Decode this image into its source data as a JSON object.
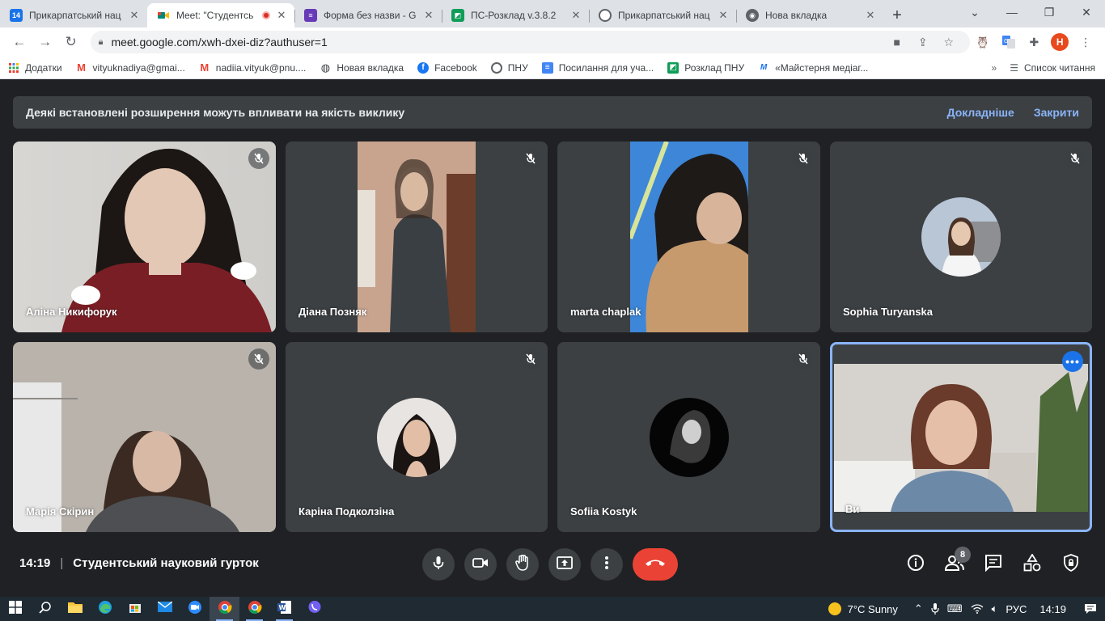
{
  "browser": {
    "tabs": [
      {
        "title": "Прикарпатський нац",
        "favicon": "calendar-icon",
        "color": "#1a73e8",
        "glyph": "14",
        "active": false
      },
      {
        "title": "Meet: \"Студентсь",
        "favicon": "meet-icon",
        "color": "#00897b",
        "glyph": "",
        "active": true,
        "recording": true
      },
      {
        "title": "Форма без назви - G",
        "favicon": "forms-icon",
        "color": "#673ab7",
        "glyph": "",
        "active": false
      },
      {
        "title": "ПС-Розклад v.3.8.2",
        "favicon": "schedule-icon",
        "color": "#0f9d58",
        "glyph": "",
        "active": false
      },
      {
        "title": "Прикарпатський нац",
        "favicon": "university-icon",
        "color": "#5f6368",
        "glyph": "",
        "active": false
      },
      {
        "title": "Нова вкладка",
        "favicon": "chrome-icon",
        "color": "#5f6368",
        "glyph": "",
        "active": false
      }
    ],
    "url": "meet.google.com/xwh-dxei-diz?authuser=1",
    "profile_initial": "H",
    "bookmarks": [
      {
        "label": "Додатки",
        "icon": "apps-grid-icon"
      },
      {
        "label": "vityuknadiya@gmai...",
        "icon": "gmail-icon"
      },
      {
        "label": "nadiia.vityuk@pnu....",
        "icon": "gmail-icon"
      },
      {
        "label": "Новая вкладка",
        "icon": "globe-icon"
      },
      {
        "label": "Facebook",
        "icon": "facebook-icon"
      },
      {
        "label": "ПНУ",
        "icon": "university-icon"
      },
      {
        "label": "Посилання для уча...",
        "icon": "docs-icon"
      },
      {
        "label": "Розклад ПНУ",
        "icon": "schedule-icon"
      },
      {
        "label": "«Майстерня медіаг...",
        "icon": "mediaglobe-icon"
      }
    ],
    "reading_list": "Список читання"
  },
  "meet": {
    "notice": {
      "message": "Деякі встановлені розширення можуть впливати на якість виклику",
      "learn_more": "Докладніше",
      "close": "Закрити"
    },
    "participants": [
      {
        "name": "Аліна Никифорук",
        "kind": "video",
        "muted": true
      },
      {
        "name": "Діана Позняк",
        "kind": "video",
        "muted": true
      },
      {
        "name": "marta chaplak",
        "kind": "video",
        "muted": true
      },
      {
        "name": "Sophia Turyanska",
        "kind": "avatar",
        "muted": true
      },
      {
        "name": "Марія Скірин",
        "kind": "video",
        "muted": true
      },
      {
        "name": "Каріна Подколзіна",
        "kind": "avatar",
        "muted": true
      },
      {
        "name": "Sofiia Kostyk",
        "kind": "avatar",
        "muted": true
      },
      {
        "name": "Ви",
        "kind": "video",
        "muted": false,
        "self": true
      }
    ],
    "time": "14:19",
    "meeting_title": "Студентський науковий гурток",
    "participant_count": "8"
  },
  "taskbar": {
    "weather": "7°C  Sunny",
    "lang": "РУС",
    "clock": "14:19"
  },
  "colors": {
    "meet_bg": "#202124",
    "tile_bg": "#3c4043",
    "accent": "#8ab4f8",
    "end_call": "#ea4335"
  }
}
